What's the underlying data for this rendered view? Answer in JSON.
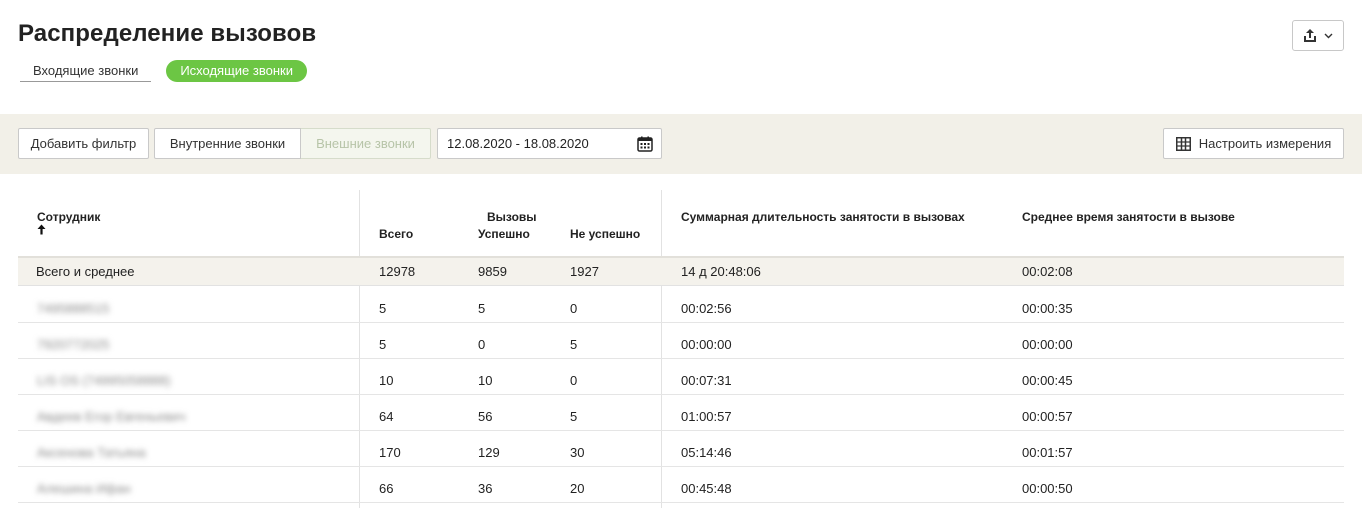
{
  "page": {
    "title": "Распределение вызовов"
  },
  "tabs": {
    "incoming": "Входящие звонки",
    "outgoing": "Исходящие звонки"
  },
  "toolbar": {
    "add_filter": "Добавить фильтр",
    "internal_calls": "Внутренние звонки",
    "external_calls": "Внешние звонки",
    "date_range": "12.08.2020 - 18.08.2020",
    "configure_measures": "Настроить измерения"
  },
  "table": {
    "headers": {
      "employee": "Сотрудник",
      "calls_group": "Вызовы",
      "total": "Всего",
      "success": "Успешно",
      "fail": "Не успешно",
      "sum_duration": "Суммарная длительность занятости в вызовах",
      "avg_duration": "Среднее время занятости в вызове"
    },
    "total_row": {
      "label": "Всего и среднее",
      "total": "12978",
      "success": "9859",
      "fail": "1927",
      "sum_duration": "14 д 20:48:06",
      "avg_duration": "00:02:08"
    },
    "rows": [
      {
        "name": "7495888515",
        "total": "5",
        "success": "5",
        "fail": "0",
        "sum_duration": "00:02:56",
        "avg_duration": "00:00:35"
      },
      {
        "name": "7920772025",
        "total": "5",
        "success": "0",
        "fail": "5",
        "sum_duration": "00:00:00",
        "avg_duration": "00:00:00"
      },
      {
        "name": "LIS OS (74995058888)",
        "total": "10",
        "success": "10",
        "fail": "0",
        "sum_duration": "00:07:31",
        "avg_duration": "00:00:45"
      },
      {
        "name": "Авдеев Егор Евгеньевич",
        "total": "64",
        "success": "56",
        "fail": "5",
        "sum_duration": "01:00:57",
        "avg_duration": "00:00:57"
      },
      {
        "name": "Аксенова Татьяна",
        "total": "170",
        "success": "129",
        "fail": "30",
        "sum_duration": "05:14:46",
        "avg_duration": "00:01:57"
      },
      {
        "name": "Алешина Ифан",
        "total": "66",
        "success": "36",
        "fail": "20",
        "sum_duration": "00:45:48",
        "avg_duration": "00:00:50"
      }
    ]
  },
  "colors": {
    "accent_green": "#6cc644",
    "toolbar_bg": "#f2f0e8"
  },
  "icons": {
    "export": "export-icon",
    "dropdown": "chevron-down-icon",
    "calendar": "calendar-icon",
    "sort": "sort-up-icon",
    "measure": "columns-icon"
  }
}
